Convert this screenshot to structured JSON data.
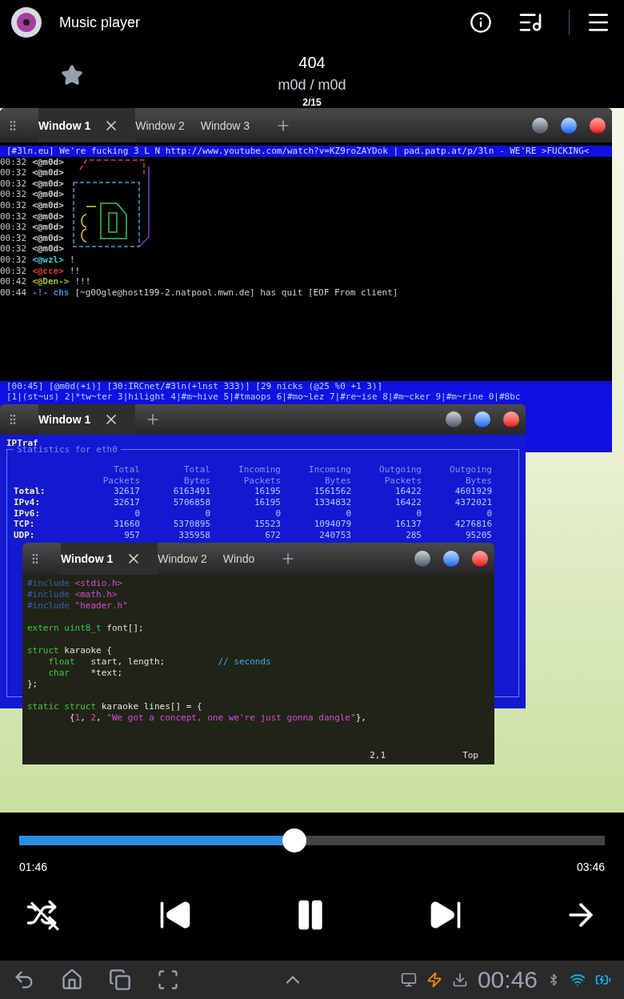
{
  "app_bar": {
    "title": "Music player"
  },
  "track": {
    "title": "404",
    "artist": "m0d / m0d",
    "position": "2/15",
    "starred": false
  },
  "album_art": {
    "windows": [
      {
        "kind": "irc",
        "tabs": [
          {
            "label": "Window 1",
            "selected": true
          },
          {
            "label": "Window 2",
            "selected": false
          },
          {
            "label": "Window 3",
            "selected": false
          }
        ],
        "topic": "[#3ln.eu] We're fucking 3 L N http://www.youtube.com/watch?v=KZ9roZAYDok | pad.patp.at/p/3ln - WE'RE >FUCKING<",
        "lines": [
          {
            "time": "00:32",
            "nick": "<@m0d>",
            "color": "#c8c8c8"
          },
          {
            "time": "00:32",
            "nick": "<@m0d>",
            "color": "#c8c8c8"
          },
          {
            "time": "00:32",
            "nick": "<@m0d>",
            "color": "#c8c8c8"
          },
          {
            "time": "00:32",
            "nick": "<@m0d>",
            "color": "#c8c8c8"
          },
          {
            "time": "00:32",
            "nick": "<@m0d>",
            "color": "#c8c8c8"
          },
          {
            "time": "00:32",
            "nick": "<@m0d>",
            "color": "#c8c8c8"
          },
          {
            "time": "00:32",
            "nick": "<@m0d>",
            "color": "#c8c8c8"
          },
          {
            "time": "00:32",
            "nick": "<@m0d>",
            "color": "#c8c8c8"
          },
          {
            "time": "00:32",
            "nick": "<@m0d>",
            "color": "#c8c8c8"
          },
          {
            "time": "00:32",
            "nick": "<@wzl>",
            "color": "#3ec8d8",
            "text": "!"
          },
          {
            "time": "00:32",
            "nick": "<@cce>",
            "color": "#d83a3a",
            "text": "!!"
          },
          {
            "time": "00:42",
            "nick": "<@Den->",
            "color": "#a8b830",
            "text": "!!!"
          },
          {
            "time": "00:44",
            "nick": "-!- chs",
            "color": "#3a8fd8",
            "text": "[~g0Ogle@host199-2.natpool.mwn.de] has quit [EOF From client]"
          }
        ],
        "status_lines": [
          "[00:45] [@m0d(+i)] [30:IRCnet/#3ln(+lnst 333)] [29 nicks (@25 %0 +1 3)]",
          "[1|(st~us) 2|*tw~ter 3|hilight 4|#m~hive 5|#tmaops 6|#mo~lez 7|#re~ise 8|#m~cker 9|#m~rine 0|#8bc"
        ]
      },
      {
        "kind": "iptraf",
        "tabs": [
          {
            "label": "Window 1",
            "selected": true
          }
        ],
        "title": "IPTraf",
        "box_label": "Statistics for eth0",
        "columns": [
          [
            "Total",
            "Packets"
          ],
          [
            "Total",
            "Bytes"
          ],
          [
            "Incoming",
            "Packets"
          ],
          [
            "Incoming",
            "Bytes"
          ],
          [
            "Outgoing",
            "Packets"
          ],
          [
            "Outgoing",
            "Bytes"
          ]
        ],
        "rows": [
          {
            "label": "Total:",
            "values": [
              "32617",
              "6163491",
              "16195",
              "1561562",
              "16422",
              "4601929"
            ]
          },
          {
            "label": "IPv4:",
            "values": [
              "32617",
              "5706858",
              "16195",
              "1334832",
              "16422",
              "4372021"
            ]
          },
          {
            "label": "IPv6:",
            "values": [
              "0",
              "0",
              "0",
              "0",
              "0",
              "0"
            ]
          },
          {
            "label": "TCP:",
            "values": [
              "31660",
              "5370895",
              "15523",
              "1094079",
              "16137",
              "4276816"
            ]
          },
          {
            "label": "UDP:",
            "values": [
              "957",
              "335958",
              "672",
              "240753",
              "285",
              "95205"
            ]
          }
        ]
      },
      {
        "kind": "editor",
        "tabs": [
          {
            "label": "Window 1",
            "selected": true
          },
          {
            "label": "Window 2",
            "selected": false
          },
          {
            "label": "Windo",
            "selected": false
          }
        ],
        "code": [
          {
            "spaced": false,
            "parts": [
              {
                "text": "#include ",
                "kind": "preproc"
              },
              {
                "text": "<stdio.h>",
                "kind": "string"
              }
            ]
          },
          {
            "spaced": false,
            "parts": [
              {
                "text": "#include ",
                "kind": "preproc"
              },
              {
                "text": "<math.h>",
                "kind": "string"
              }
            ]
          },
          {
            "spaced": false,
            "parts": [
              {
                "text": "#include ",
                "kind": "preproc"
              },
              {
                "text": "\"header.h\"",
                "kind": "string"
              }
            ]
          },
          {
            "spaced": true,
            "parts": [
              {
                "text": "extern uint8_t",
                "kind": "type"
              },
              {
                "text": " font[];",
                "kind": "plain"
              }
            ]
          },
          {
            "spaced": true,
            "parts": [
              {
                "text": "struct",
                "kind": "type"
              },
              {
                "text": " karaoke {",
                "kind": "plain"
              }
            ]
          },
          {
            "spaced": false,
            "parts": [
              {
                "text": "    float",
                "kind": "type"
              },
              {
                "text": "   start, length;          ",
                "kind": "plain"
              },
              {
                "text": "// seconds",
                "kind": "comment"
              }
            ]
          },
          {
            "spaced": false,
            "parts": [
              {
                "text": "    char",
                "kind": "type"
              },
              {
                "text": "    *text;",
                "kind": "plain"
              }
            ]
          },
          {
            "spaced": false,
            "parts": [
              {
                "text": "};",
                "kind": "plain"
              }
            ]
          },
          {
            "spaced": true,
            "parts": [
              {
                "text": "static struct",
                "kind": "type"
              },
              {
                "text": " karaoke lines[] = {",
                "kind": "plain"
              }
            ]
          },
          {
            "spaced": false,
            "parts": [
              {
                "text": "        {",
                "kind": "plain"
              },
              {
                "text": "1",
                "kind": "string"
              },
              {
                "text": ", ",
                "kind": "plain"
              },
              {
                "text": "2",
                "kind": "string"
              },
              {
                "text": ", ",
                "kind": "plain"
              },
              {
                "text": "\"We got a concept, one we're just gonna dangle\"",
                "kind": "string"
              },
              {
                "text": "},",
                "kind": "plain"
              }
            ]
          }
        ],
        "cursor": "2,1",
        "scroll": "Top"
      }
    ]
  },
  "progress": {
    "level": 0.47,
    "elapsed": "01:46",
    "total": "03:46"
  },
  "controls": {
    "shuffle": false,
    "playing": true
  },
  "system_bar": {
    "time": "00:46"
  }
}
